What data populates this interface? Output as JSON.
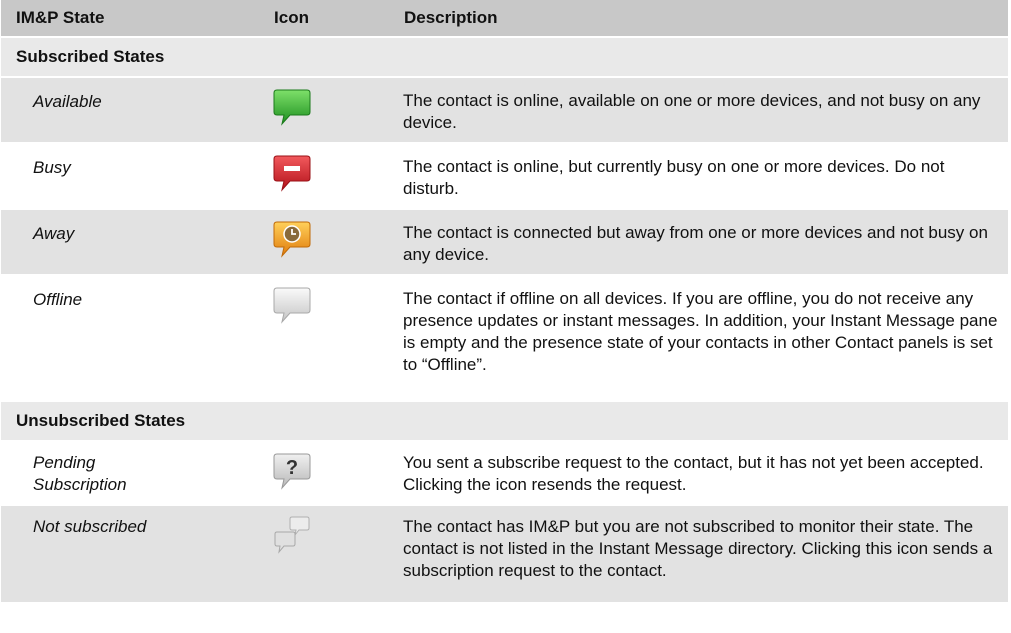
{
  "headers": {
    "state": "IM&P State",
    "icon": "Icon",
    "description": "Description"
  },
  "sections": [
    {
      "title": "Subscribed States",
      "rows": [
        {
          "state": "Available",
          "icon": "green-speech-bubble-icon",
          "description": "The contact is online, available on one or more devices, and not busy on any device."
        },
        {
          "state": "Busy",
          "icon": "red-busy-bubble-icon",
          "description": "The contact is online, but currently busy on one or more devices. Do not disturb."
        },
        {
          "state": "Away",
          "icon": "orange-clock-bubble-icon",
          "description": "The contact is connected but away from one or more devices and not busy on any device."
        },
        {
          "state": "Offline",
          "icon": "gray-speech-bubble-icon",
          "description": "The contact if offline on all devices. If you are offline, you do not receive any presence updates or instant messages. In addition, your Instant Message pane is empty and the presence state of your contacts in other Contact panels is set to “Offline”."
        }
      ]
    },
    {
      "title": "Unsubscribed States",
      "rows": [
        {
          "state": "Pending Subscription",
          "icon": "question-bubble-icon",
          "description": "You sent a subscribe request to the contact, but it has not yet been accepted. Clicking the icon resends the request."
        },
        {
          "state": "Not subscribed",
          "icon": "double-gray-bubble-icon",
          "description": "The contact has IM&P but you are not subscribed to monitor their state. The contact is not listed in the Instant Message directory. Clicking this icon sends a subscription request to the contact."
        }
      ]
    }
  ],
  "colors": {
    "header_bg": "#c8c8c8",
    "section_bg": "#e9e9e9",
    "shaded_row_bg": "#e2e2e2",
    "available": "#2eaa2a",
    "busy": "#d21e24",
    "away": "#f29a14",
    "offline": "#d8d8d8"
  }
}
